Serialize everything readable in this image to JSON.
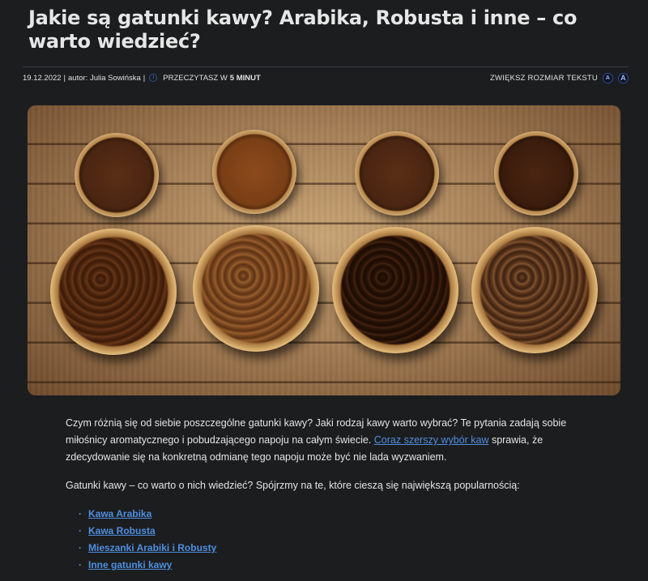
{
  "article": {
    "title": "Jakie są gatunki kawy? Arabika, Robusta i inne – co warto wiedzieć?",
    "meta": {
      "date": "19.12.2022",
      "author": "autor: Julia Sowińska",
      "separator": "|",
      "read_prefix": "PRZECZYTASZ W",
      "read_time": "5 MINUT",
      "font_size_label": "ZWIĘKSZ ROZMIAR TEKSTU",
      "font_small_label": "A",
      "font_large_label": "A",
      "clock_icon": "clock-icon"
    },
    "hero_image": {
      "icon": "coffee-bowls-photo"
    },
    "paragraph1": {
      "before_link": "Czym różnią się od siebie poszczególne gatunki kawy? Jaki rodzaj kawy warto wybrać? Te pytania zadają sobie miłośnicy aromatycznego i pobudzającego napoju na całym świecie. ",
      "link_text": "Coraz szerszy wybór kaw",
      "after_link": " sprawia, że zdecydowanie się na konkretną odmianę tego napoju może być nie lada wyzwaniem."
    },
    "paragraph2": "Gatunki kawy – co warto o nich wiedzieć? Spójrzmy na te, które cieszą się największą popularnością:",
    "toc": [
      "Kawa Arabika",
      "Kawa Robusta",
      "Mieszanki Arabiki i Robusty",
      "Inne gatunki kawy"
    ],
    "colors": {
      "background": "#1c1d1f",
      "link": "#4f8fe0",
      "accent_border": "#2c4a9a"
    }
  }
}
